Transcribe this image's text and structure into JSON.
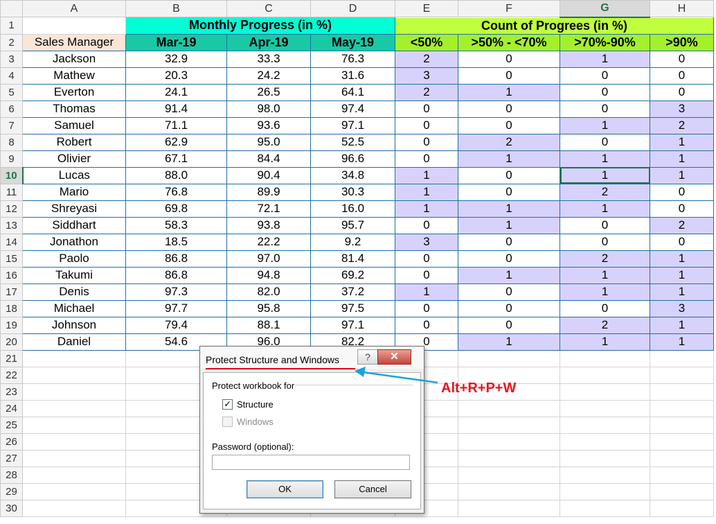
{
  "sheet": {
    "columns": [
      "A",
      "B",
      "C",
      "D",
      "E",
      "F",
      "G",
      "H"
    ],
    "selected_column": "G",
    "selected_row": 10,
    "group_headers": {
      "monthly": "Monthly Progress (in %)",
      "count": "Count of Progrees (in %)"
    },
    "subheaders": {
      "manager": "Sales Manager",
      "months": [
        "Mar-19",
        "Apr-19",
        "May-19"
      ],
      "buckets": [
        "<50%",
        ">50% - <70%",
        ">70%-90%",
        ">90%"
      ]
    },
    "rows": [
      {
        "name": "Jackson",
        "mar": "32.9",
        "apr": "33.3",
        "may": "76.3",
        "b1": "2",
        "b2": "0",
        "b3": "1",
        "b4": "0"
      },
      {
        "name": "Mathew",
        "mar": "20.3",
        "apr": "24.2",
        "may": "31.6",
        "b1": "3",
        "b2": "0",
        "b3": "0",
        "b4": "0"
      },
      {
        "name": "Everton",
        "mar": "24.1",
        "apr": "26.5",
        "may": "64.1",
        "b1": "2",
        "b2": "1",
        "b3": "0",
        "b4": "0"
      },
      {
        "name": "Thomas",
        "mar": "91.4",
        "apr": "98.0",
        "may": "97.4",
        "b1": "0",
        "b2": "0",
        "b3": "0",
        "b4": "3"
      },
      {
        "name": "Samuel",
        "mar": "71.1",
        "apr": "93.6",
        "may": "97.1",
        "b1": "0",
        "b2": "0",
        "b3": "1",
        "b4": "2"
      },
      {
        "name": "Robert",
        "mar": "62.9",
        "apr": "95.0",
        "may": "52.5",
        "b1": "0",
        "b2": "2",
        "b3": "0",
        "b4": "1"
      },
      {
        "name": "Olivier",
        "mar": "67.1",
        "apr": "84.4",
        "may": "96.6",
        "b1": "0",
        "b2": "1",
        "b3": "1",
        "b4": "1"
      },
      {
        "name": "Lucas",
        "mar": "88.0",
        "apr": "90.4",
        "may": "34.8",
        "b1": "1",
        "b2": "0",
        "b3": "1",
        "b4": "1"
      },
      {
        "name": "Mario",
        "mar": "76.8",
        "apr": "89.9",
        "may": "30.3",
        "b1": "1",
        "b2": "0",
        "b3": "2",
        "b4": "0"
      },
      {
        "name": "Shreyasi",
        "mar": "69.8",
        "apr": "72.1",
        "may": "16.0",
        "b1": "1",
        "b2": "1",
        "b3": "1",
        "b4": "0"
      },
      {
        "name": "Siddhart",
        "mar": "58.3",
        "apr": "93.8",
        "may": "95.7",
        "b1": "0",
        "b2": "1",
        "b3": "0",
        "b4": "2"
      },
      {
        "name": "Jonathon",
        "mar": "18.5",
        "apr": "22.2",
        "may": "9.2",
        "b1": "3",
        "b2": "0",
        "b3": "0",
        "b4": "0"
      },
      {
        "name": "Paolo",
        "mar": "86.8",
        "apr": "97.0",
        "may": "81.4",
        "b1": "0",
        "b2": "0",
        "b3": "2",
        "b4": "1"
      },
      {
        "name": "Takumi",
        "mar": "86.8",
        "apr": "94.8",
        "may": "69.2",
        "b1": "0",
        "b2": "1",
        "b3": "1",
        "b4": "1"
      },
      {
        "name": "Denis",
        "mar": "97.3",
        "apr": "82.0",
        "may": "37.2",
        "b1": "1",
        "b2": "0",
        "b3": "1",
        "b4": "1"
      },
      {
        "name": "Michael",
        "mar": "97.7",
        "apr": "95.8",
        "may": "97.5",
        "b1": "0",
        "b2": "0",
        "b3": "0",
        "b4": "3"
      },
      {
        "name": "Johnson",
        "mar": "79.4",
        "apr": "88.1",
        "may": "97.1",
        "b1": "0",
        "b2": "0",
        "b3": "2",
        "b4": "1"
      },
      {
        "name": "Daniel",
        "mar": "54.6",
        "apr": "96.0",
        "may": "82.2",
        "b1": "0",
        "b2": "1",
        "b3": "1",
        "b4": "1"
      }
    ],
    "empty_row_numbers": [
      "21",
      "22",
      "23",
      "24",
      "25",
      "26",
      "27",
      "28",
      "29",
      "30"
    ],
    "colors": {
      "teal_header": "#00ffd5",
      "teal_sub": "#19c9a6",
      "lime_header": "#bfff3f",
      "lime_sub": "#a4f02a",
      "highlight": "#d7d2fb",
      "manager_header": "#fde5d6"
    }
  },
  "dialog": {
    "title": "Protect Structure and Windows",
    "help_label": "?",
    "close_label": "✕",
    "group_label": "Protect workbook for",
    "structure_label": "Structure",
    "structure_checked": true,
    "windows_label": "Windows",
    "windows_checked": false,
    "password_label": "Password (optional):",
    "password_value": "",
    "ok_label": "OK",
    "cancel_label": "Cancel"
  },
  "annotation": {
    "shortcut": "Alt+R+P+W",
    "arrow_color": "#1aa3e0",
    "text_color": "#e8141e"
  }
}
